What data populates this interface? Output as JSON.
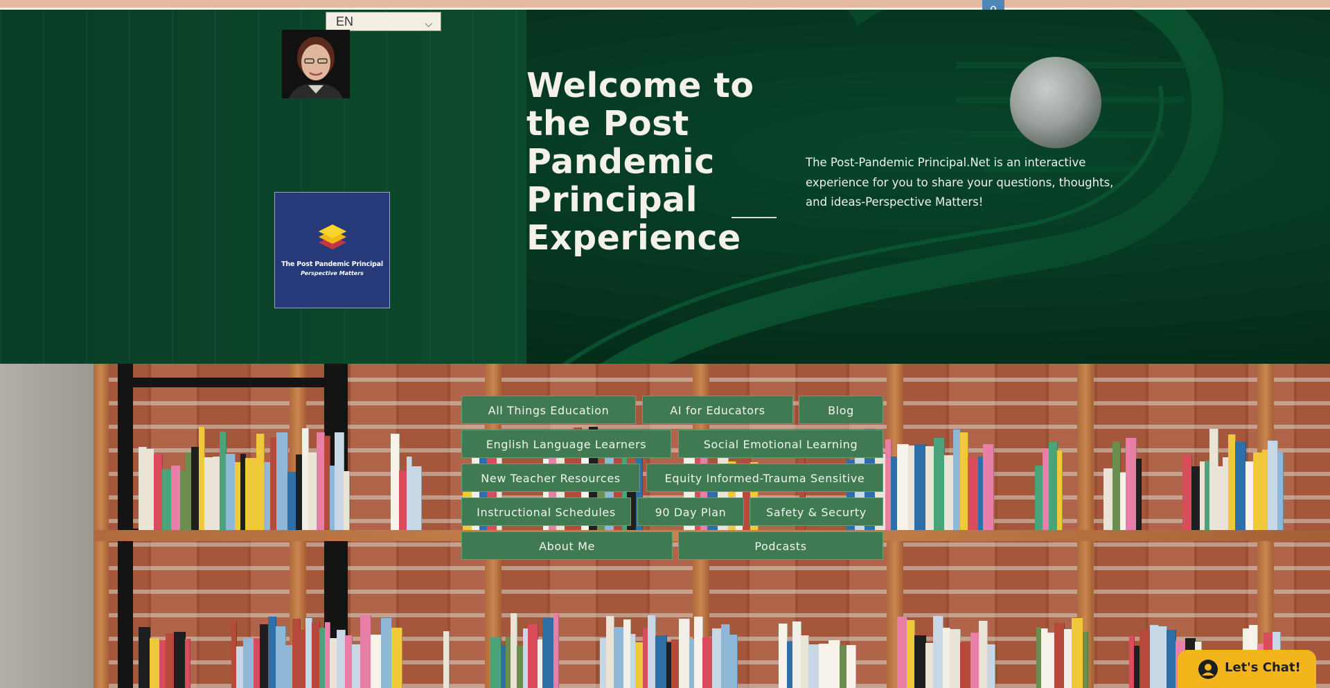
{
  "topbar": {
    "cart_count": "0"
  },
  "language": {
    "selected": "EN"
  },
  "hero": {
    "title": "Welcome to the Post Pandemic Principal Experience",
    "description": " The Post-Pandemic Principal.Net is an interactive experience for you to share your questions, thoughts, and ideas-Perspective Matters!"
  },
  "logo": {
    "title": "The Post Pandemic Principal",
    "subtitle": "Perspective Matters"
  },
  "nav": {
    "items": [
      "All Things Education",
      "AI for Educators",
      "Blog",
      "English Language Learners",
      "Social Emotional Learning",
      "New Teacher Resources",
      "Equity Informed-Trauma Sensitive",
      "Instructional Schedules",
      "90 Day Plan",
      "Safety & Securty",
      "About Me",
      "Podcasts"
    ]
  },
  "chat": {
    "label": "Let's Chat!"
  },
  "colors": {
    "hero_green": "#063620",
    "nav_button": "#3f7a52",
    "chat_button": "#f2b51c",
    "cart_badge": "#4f86b8",
    "logo_navy": "#263a79"
  }
}
